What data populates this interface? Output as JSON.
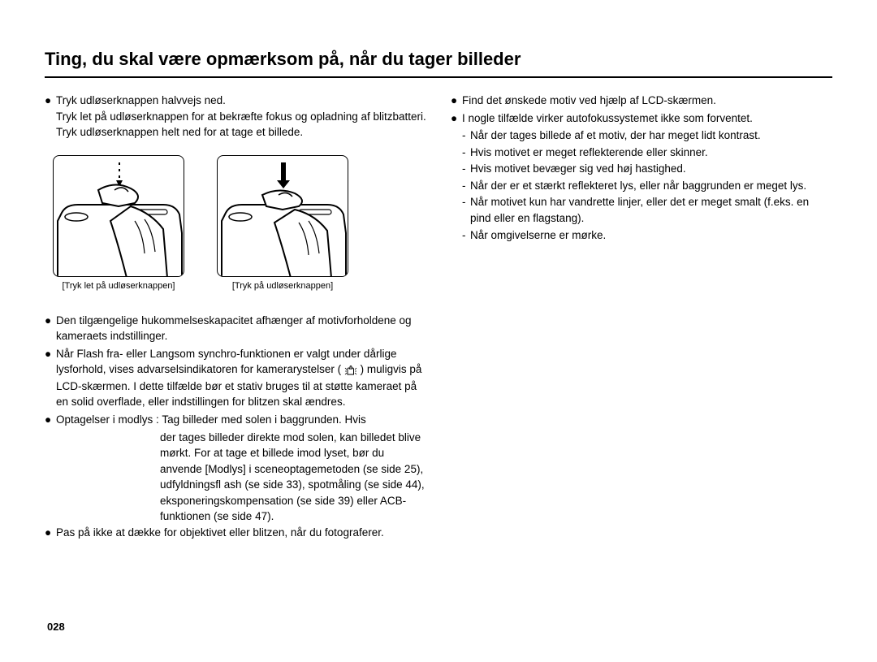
{
  "title": "Ting, du skal være opmærksom på, når du tager billeder",
  "pageNumber": "028",
  "left": {
    "b1_lead": "Tryk udløserknappen halvvejs ned.",
    "b1_body": "Tryk let på udløserknappen for at bekræfte fokus og opladning af blitzbatteri. Tryk udløserknappen helt ned for at tage et billede.",
    "fig1_caption": "[Tryk let på udløserknappen]",
    "fig2_caption": "[Tryk på udløserknappen]",
    "b2": "Den tilgængelige hukommelseskapacitet afhænger af motivforholdene og kameraets indstillinger.",
    "b3_a": "Når Flash fra- eller Langsom synchro-funktionen er valgt under dårlige lysforhold, vises advarselsindikatoren for kamerarystelser",
    "b3_b": ") muligvis på LCD-skærmen. I dette tilfælde bør et stativ bruges til at støtte kameraet på en solid overflade, eller indstillingen for blitzen skal ændres.",
    "b4_lead": "Optagelser i modlys :",
    "b4_body1": "Tag billeder med solen i baggrunden. Hvis",
    "b4_body2": "der tages billeder direkte mod solen, kan billedet blive mørkt. For at tage et billede imod lyset, bør du anvende [Modlys] i sceneoptagemetoden (se side 25), udfyldningsfl ash (se side 33), spotmåling (se side 44), eksponeringskompensation (se side 39) eller ACB-funktionen (se side 47).",
    "b5": "Pas på ikke at dække for objektivet eller blitzen, når du fotograferer."
  },
  "right": {
    "b1": "Find det ønskede motiv ved hjælp af LCD-skærmen.",
    "b2_lead": "I nogle tilfælde virker autofokussystemet ikke som forventet.",
    "d1": "Når der tages billede af et motiv, der har meget lidt kontrast.",
    "d2": "Hvis motivet er meget reflekterende eller skinner.",
    "d3": "Hvis motivet bevæger sig ved høj hastighed.",
    "d4": "Når der er et stærkt reflekteret lys, eller når baggrunden er meget lys.",
    "d5": "Når motivet kun har vandrette linjer, eller det er meget smalt (f.eks. en pind eller en flagstang).",
    "d6": "Når omgivelserne er mørke."
  }
}
